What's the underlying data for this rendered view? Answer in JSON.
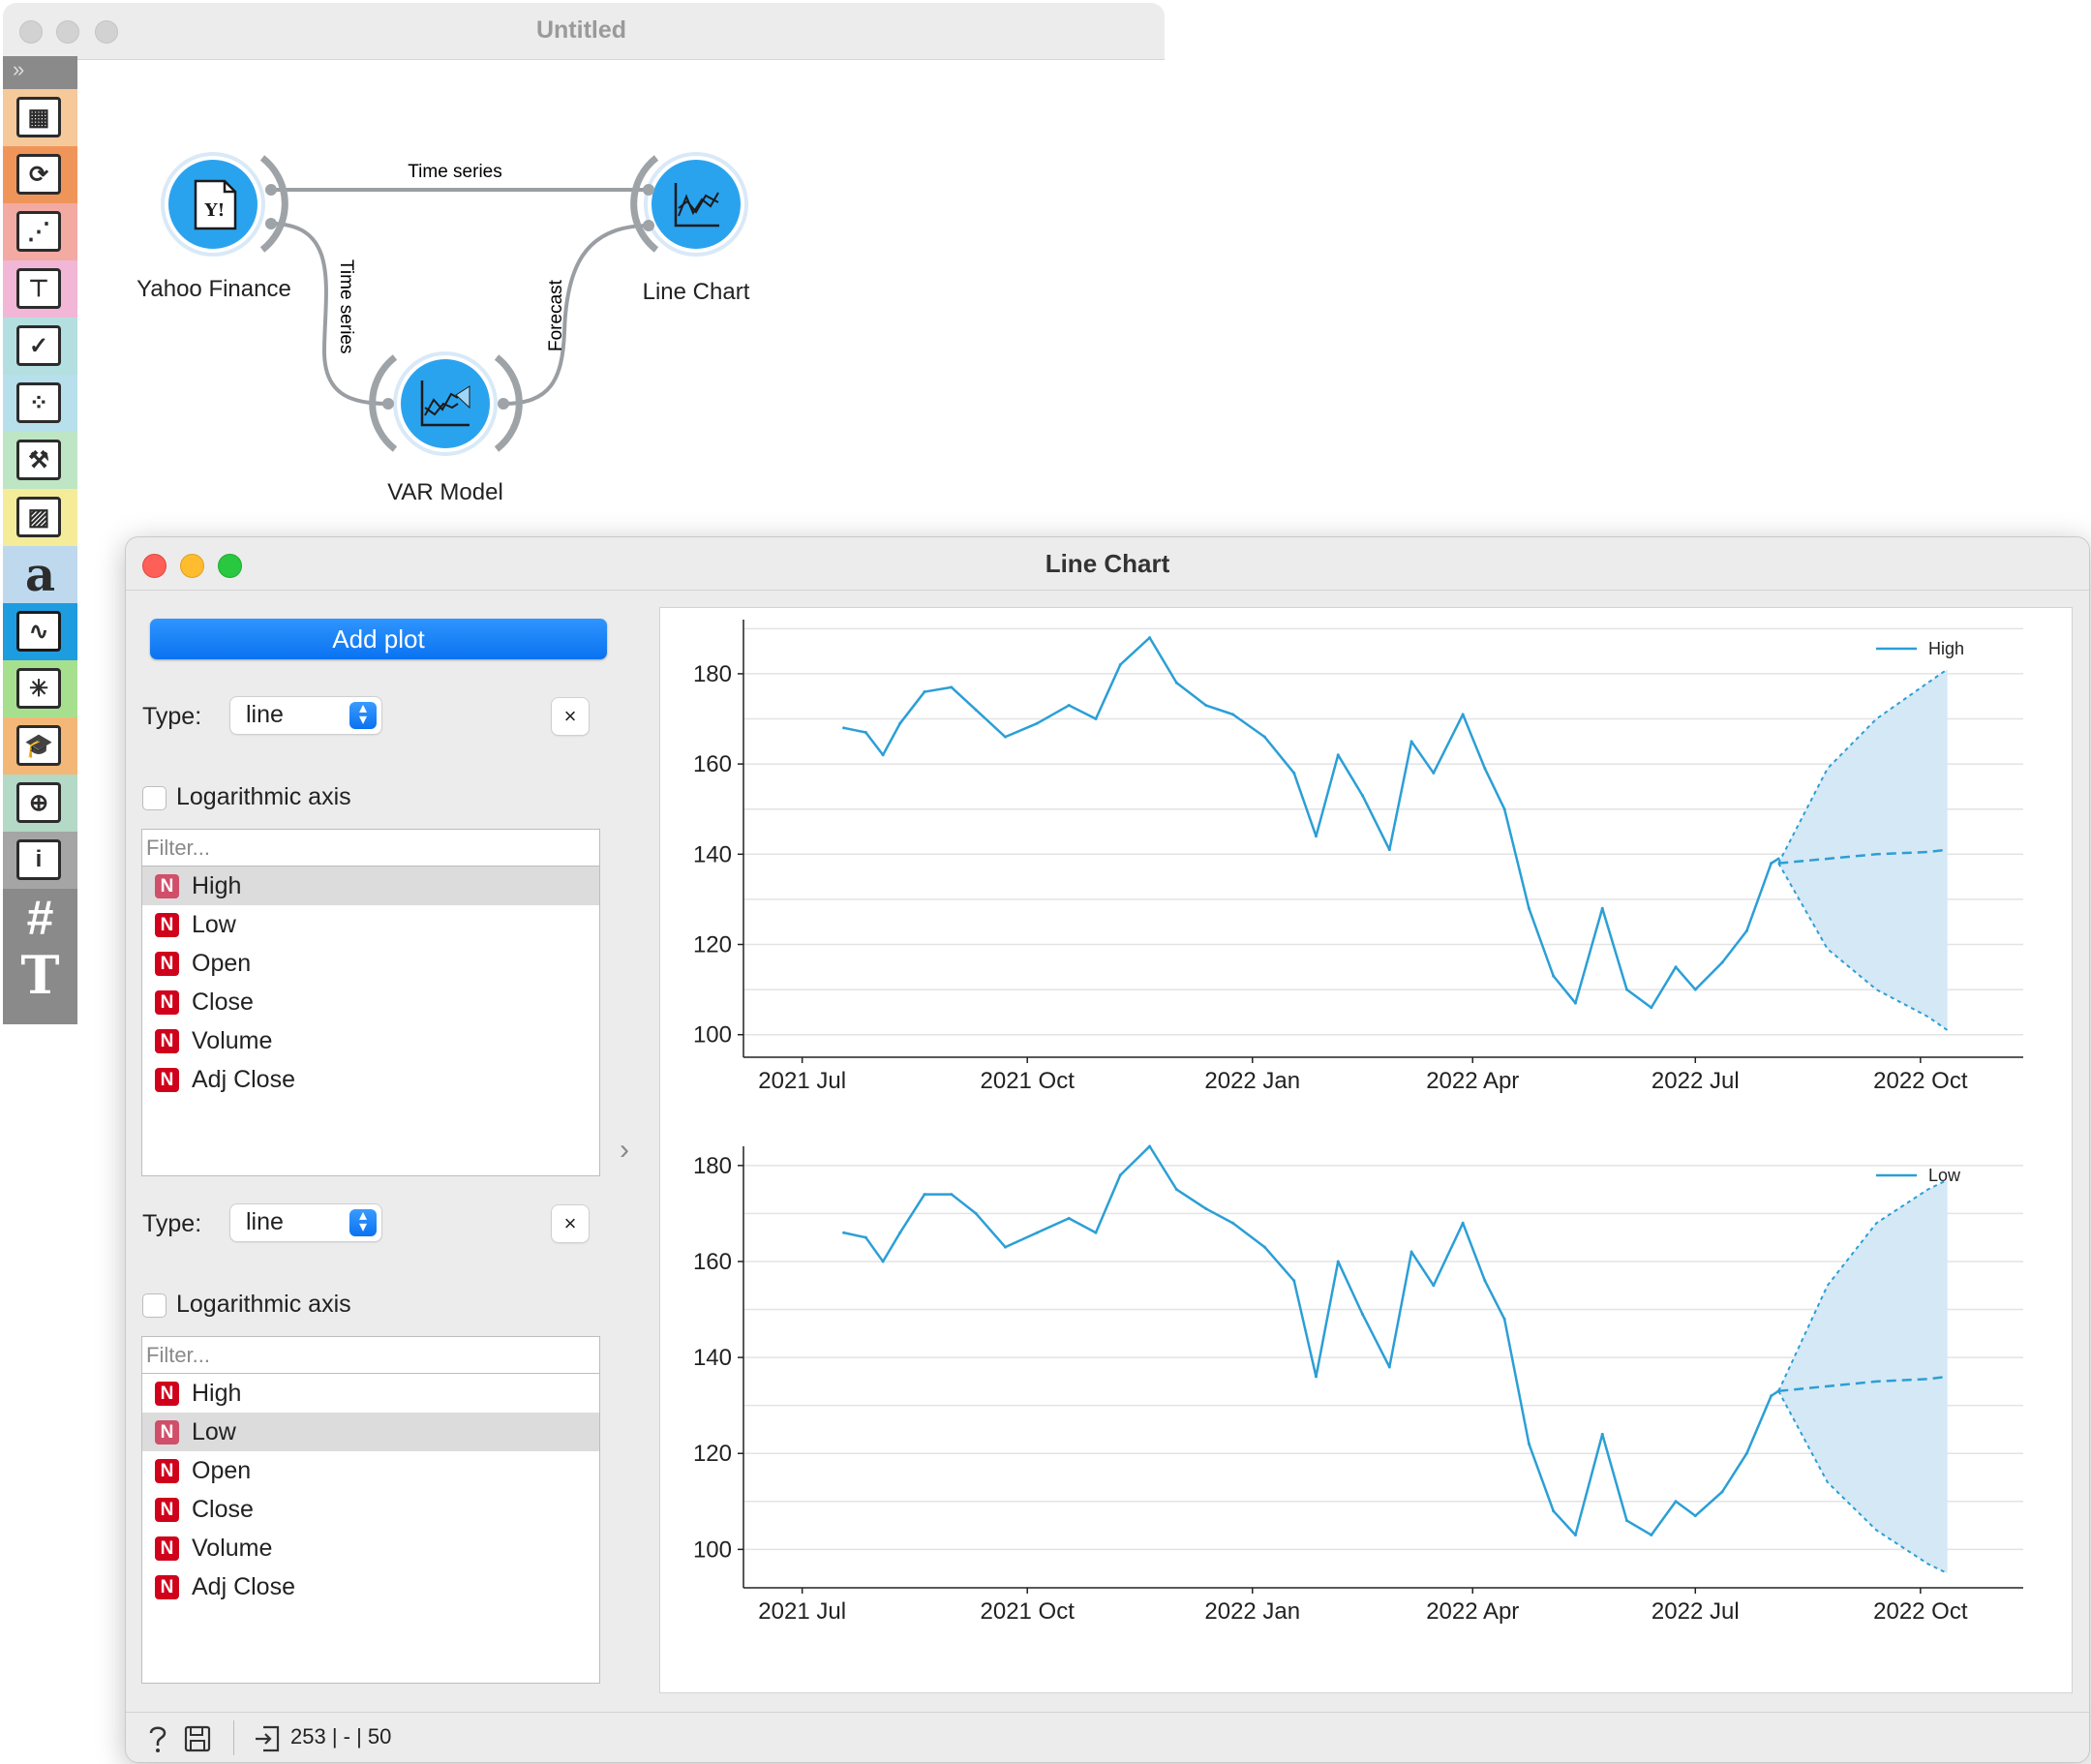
{
  "canvas": {
    "title": "Untitled",
    "nodes": {
      "yahoo": "Yahoo Finance",
      "linechart": "Line Chart",
      "var": "VAR Model"
    },
    "links": {
      "top": "Time series",
      "left": "Time series",
      "right": "Forecast"
    }
  },
  "toolbox": {
    "categories": [
      {
        "icon": "data-table-icon",
        "color": "#f5c99a"
      },
      {
        "icon": "transform-icon",
        "color": "#f0955a"
      },
      {
        "icon": "scatter-visualize-icon",
        "color": "#f2aaa2"
      },
      {
        "icon": "tree-model-icon",
        "color": "#f2b6d6"
      },
      {
        "icon": "evaluate-grid-icon",
        "color": "#b3dfe0"
      },
      {
        "icon": "cluster-unsupervised-icon",
        "color": "#b7e0ec"
      },
      {
        "icon": "survival-icon",
        "color": "#bfe6c4"
      },
      {
        "icon": "image-analytics-icon",
        "color": "#f5ec9a"
      },
      {
        "icon": "text-mining-icon",
        "color": "#bed9ee"
      },
      {
        "icon": "time-series-icon",
        "color": "#1e9ce0"
      },
      {
        "icon": "network-icon",
        "color": "#a6e08f"
      },
      {
        "icon": "education-icon",
        "color": "#f3b877"
      },
      {
        "icon": "geo-icon",
        "color": "#b4d9c6"
      },
      {
        "icon": "info-icon",
        "color": "#a5a5a5"
      },
      {
        "icon": "hash-icon",
        "color": "#8a8a8a"
      },
      {
        "icon": "text-tool-icon",
        "color": "#8a8a8a"
      }
    ],
    "text_glyph": "a",
    "text_tool_glyph": "T"
  },
  "linechart_window": {
    "title": "Line Chart",
    "add_plot_label": "Add plot",
    "control_groups": [
      {
        "type_label": "Type:",
        "type_value": "line",
        "log_label": "Logarithmic axis",
        "filter_placeholder": "Filter...",
        "selected": "High"
      },
      {
        "type_label": "Type:",
        "type_value": "line",
        "log_label": "Logarithmic axis",
        "filter_placeholder": "Filter...",
        "selected": "Low"
      }
    ],
    "variables": [
      "High",
      "Low",
      "Open",
      "Close",
      "Volume",
      "Adj Close"
    ],
    "var_badge": "N",
    "close_glyph": "×",
    "status_text": "253 | - | 50"
  },
  "colors": {
    "series_line": "#2b9fd6",
    "forecast_band": "#d5e8f5",
    "grid": "#e3e3e3",
    "accent_blue": "#0a72f0",
    "var_badge": "#d0021b"
  },
  "chart_data": [
    {
      "type": "line",
      "series": [
        {
          "name": "High",
          "x": [
            "2021-07-18",
            "2021-07-27",
            "2021-08-03",
            "2021-08-10",
            "2021-08-20",
            "2021-08-31",
            "2021-09-10",
            "2021-09-22",
            "2021-10-05",
            "2021-10-18",
            "2021-10-29",
            "2021-11-08",
            "2021-11-20",
            "2021-12-01",
            "2021-12-13",
            "2021-12-24",
            "2022-01-06",
            "2022-01-18",
            "2022-01-27",
            "2022-02-05",
            "2022-02-15",
            "2022-02-26",
            "2022-03-07",
            "2022-03-16",
            "2022-03-28",
            "2022-04-06",
            "2022-04-14",
            "2022-04-24",
            "2022-05-04",
            "2022-05-13",
            "2022-05-24",
            "2022-06-03",
            "2022-06-13",
            "2022-06-23",
            "2022-07-01",
            "2022-07-12",
            "2022-07-22",
            "2022-08-01",
            "2022-08-04"
          ],
          "values": [
            168,
            167,
            162,
            169,
            176,
            177,
            172,
            166,
            169,
            173,
            170,
            182,
            188,
            178,
            173,
            171,
            166,
            158,
            144,
            162,
            153,
            141,
            165,
            158,
            171,
            159,
            150,
            128,
            113,
            107,
            128,
            110,
            106,
            115,
            110,
            116,
            123,
            138,
            139
          ]
        },
        {
          "name": "High forecast",
          "x": [
            "2022-08-04",
            "2022-08-24",
            "2022-09-13",
            "2022-10-04",
            "2022-10-12"
          ],
          "values": [
            138,
            139,
            140,
            140.5,
            141
          ],
          "lower": [
            138,
            119,
            110,
            104,
            101
          ],
          "upper": [
            138,
            159,
            170,
            178,
            181
          ]
        }
      ],
      "x_ticks": [
        "2021 Jul",
        "2021 Oct",
        "2022 Jan",
        "2022 Apr",
        "2022 Jul",
        "2022 Oct"
      ],
      "y_ticks": [
        100,
        120,
        140,
        160,
        180
      ],
      "ylim": [
        95,
        192
      ],
      "legend": "High",
      "legend_position": "top-right",
      "grid": true
    },
    {
      "type": "line",
      "series": [
        {
          "name": "Low",
          "x": [
            "2021-07-18",
            "2021-07-27",
            "2021-08-03",
            "2021-08-10",
            "2021-08-20",
            "2021-08-31",
            "2021-09-10",
            "2021-09-22",
            "2021-10-05",
            "2021-10-18",
            "2021-10-29",
            "2021-11-08",
            "2021-11-20",
            "2021-12-01",
            "2021-12-13",
            "2021-12-24",
            "2022-01-06",
            "2022-01-18",
            "2022-01-27",
            "2022-02-05",
            "2022-02-15",
            "2022-02-26",
            "2022-03-07",
            "2022-03-16",
            "2022-03-28",
            "2022-04-06",
            "2022-04-14",
            "2022-04-24",
            "2022-05-04",
            "2022-05-13",
            "2022-05-24",
            "2022-06-03",
            "2022-06-13",
            "2022-06-23",
            "2022-07-01",
            "2022-07-12",
            "2022-07-22",
            "2022-08-01",
            "2022-08-04"
          ],
          "values": [
            166,
            165,
            160,
            166,
            174,
            174,
            170,
            163,
            166,
            169,
            166,
            178,
            184,
            175,
            171,
            168,
            163,
            156,
            136,
            160,
            149,
            138,
            162,
            155,
            168,
            156,
            148,
            122,
            108,
            103,
            124,
            106,
            103,
            110,
            107,
            112,
            120,
            132,
            133
          ]
        },
        {
          "name": "Low forecast",
          "x": [
            "2022-08-04",
            "2022-08-24",
            "2022-09-13",
            "2022-10-04",
            "2022-10-12"
          ],
          "values": [
            133,
            134,
            135,
            135.5,
            136
          ],
          "lower": [
            133,
            114,
            104,
            97,
            95
          ],
          "upper": [
            133,
            155,
            168,
            175,
            177
          ]
        }
      ],
      "x_ticks": [
        "2021 Jul",
        "2021 Oct",
        "2022 Jan",
        "2022 Apr",
        "2022 Jul",
        "2022 Oct"
      ],
      "y_ticks": [
        100,
        120,
        140,
        160,
        180
      ],
      "ylim": [
        92,
        184
      ],
      "legend": "Low",
      "legend_position": "top-right",
      "grid": true
    }
  ]
}
